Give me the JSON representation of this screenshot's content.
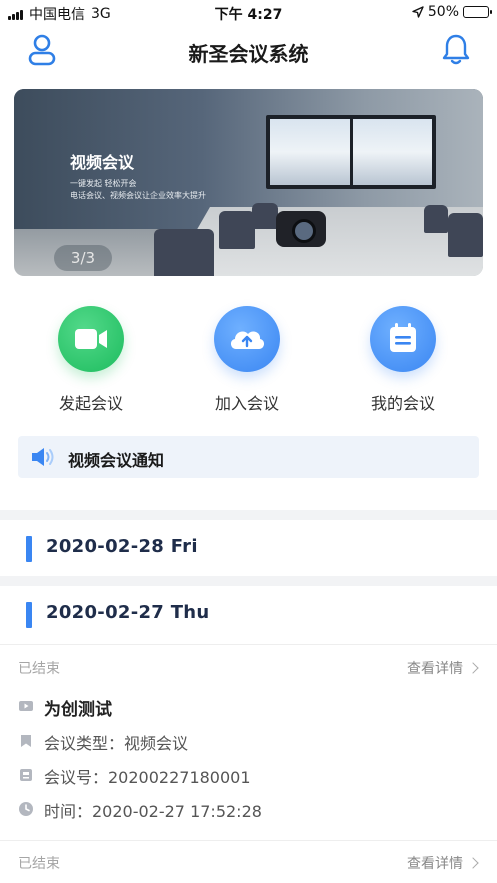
{
  "status_bar": {
    "carrier": "中国电信",
    "network": "3G",
    "time": "下午 4:27",
    "battery_text": "50%",
    "battery_level": 0.5
  },
  "nav": {
    "title": "新圣会议系统",
    "user_icon": "user-icon",
    "bell_icon": "bell-icon"
  },
  "banner": {
    "title": "视频会议",
    "line1": "一键发起 轻松开会",
    "line2": "电话会议、视频会议让企业效率大提升",
    "pager": "3/3"
  },
  "actions": [
    {
      "label": "发起会议",
      "icon": "video-camera-icon",
      "color": "#1dbc5e"
    },
    {
      "label": "加入会议",
      "icon": "cloud-upload-icon",
      "color": "#3a86f2"
    },
    {
      "label": "我的会议",
      "icon": "calendar-icon",
      "color": "#3a86f2"
    }
  ],
  "notice": {
    "text": "视频会议通知",
    "icon": "speaker-icon"
  },
  "dates": [
    {
      "date": "2020-02-28 Fri"
    },
    {
      "date": "2020-02-27 Thu"
    }
  ],
  "meetings": [
    {
      "status": "已结束",
      "detail_link": "查看详情",
      "name": "为创测试",
      "type_line": "会议类型：视频会议",
      "number_line": "会议号：20200227180001",
      "time_line": "时间：2020-02-27 17:52:28"
    },
    {
      "status": "已结束",
      "detail_link": "查看详情"
    }
  ],
  "colors": {
    "accent": "#3a86f2",
    "green": "#1dbc5e",
    "date_text": "#1f2d4a",
    "muted": "#a6a6a6"
  }
}
